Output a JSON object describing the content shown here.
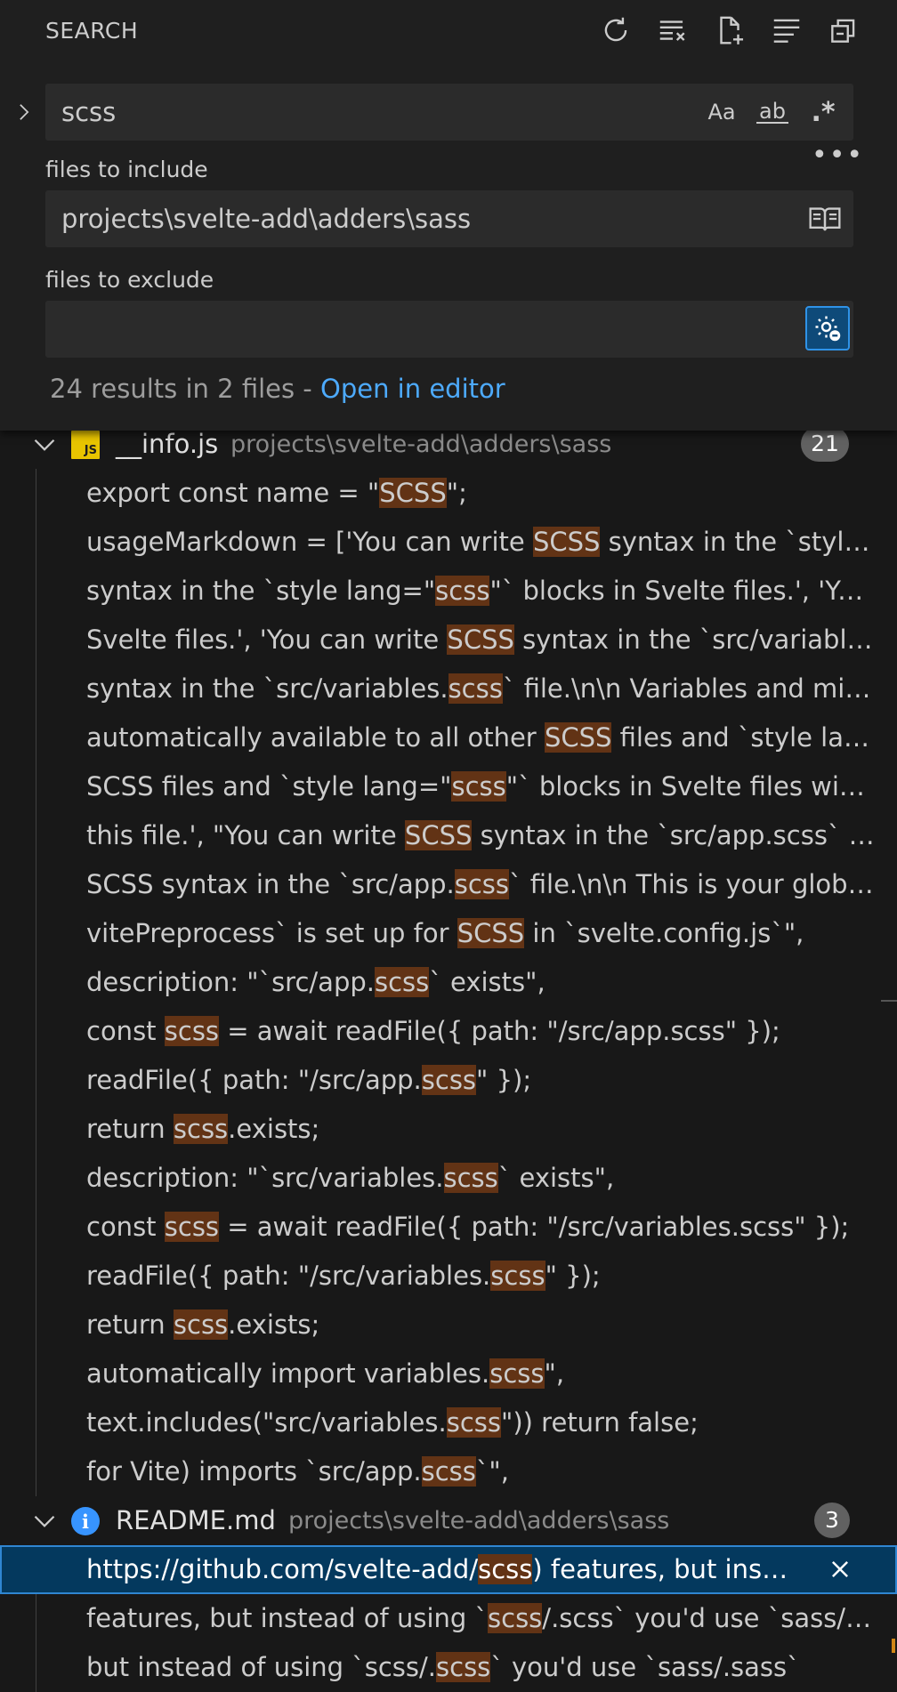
{
  "panel": {
    "title": "SEARCH",
    "toolbar": [
      {
        "name": "refresh-icon"
      },
      {
        "name": "clear-results-icon"
      },
      {
        "name": "new-search-editor-icon"
      },
      {
        "name": "view-as-tree-icon"
      },
      {
        "name": "collapse-all-icon"
      }
    ]
  },
  "search": {
    "query": "scss",
    "options": {
      "match_case": "Aa",
      "whole_word": "ab",
      "regex": ".*"
    },
    "include_label": "files to include",
    "include_value": "projects\\svelte-add\\adders\\sass",
    "exclude_label": "files to exclude",
    "exclude_value": "",
    "summary": "24 results in 2 files - ",
    "open_in_editor": "Open in editor"
  },
  "files": [
    {
      "name": "__info.js",
      "path": "projects\\svelte-add\\adders\\sass",
      "count": "21",
      "icon": "js-file-icon",
      "matches": [
        [
          {
            "t": "export const name = \""
          },
          {
            "t": "SCSS",
            "h": true
          },
          {
            "t": "\";"
          }
        ],
        [
          {
            "t": "usageMarkdown = ['You can write "
          },
          {
            "t": "SCSS",
            "h": true
          },
          {
            "t": " syntax in the `style l..."
          }
        ],
        [
          {
            "t": "syntax in the `style lang=\""
          },
          {
            "t": "scss",
            "h": true
          },
          {
            "t": "\"` blocks in Svelte files.', 'You c..."
          }
        ],
        [
          {
            "t": "Svelte files.', 'You can write "
          },
          {
            "t": "SCSS",
            "h": true
          },
          {
            "t": " syntax in the `src/variables.s..."
          }
        ],
        [
          {
            "t": "syntax in the `src/variables."
          },
          {
            "t": "scss",
            "h": true
          },
          {
            "t": "` file.\\n\\n  Variables and mixin..."
          }
        ],
        [
          {
            "t": "automatically available to all other "
          },
          {
            "t": "SCSS",
            "h": true
          },
          {
            "t": " files and `style lang..."
          }
        ],
        [
          {
            "t": "SCSS files and `style lang=\""
          },
          {
            "t": "scss",
            "h": true
          },
          {
            "t": "\"` blocks in Svelte files witho..."
          }
        ],
        [
          {
            "t": "this file.', \"You can write "
          },
          {
            "t": "SCSS",
            "h": true
          },
          {
            "t": " syntax in the `src/app.scss` file...."
          }
        ],
        [
          {
            "t": "SCSS syntax in the `src/app."
          },
          {
            "t": "scss",
            "h": true
          },
          {
            "t": "` file.\\n\\n  This is your global ..."
          }
        ],
        [
          {
            "t": "vitePreprocess` is set up for "
          },
          {
            "t": "SCSS",
            "h": true
          },
          {
            "t": " in `svelte.config.js`\","
          }
        ],
        [
          {
            "t": "description: \"`src/app."
          },
          {
            "t": "scss",
            "h": true
          },
          {
            "t": "` exists\","
          }
        ],
        [
          {
            "t": "const "
          },
          {
            "t": "scss",
            "h": true
          },
          {
            "t": " = await readFile({ path: \"/src/app.scss\" });"
          }
        ],
        [
          {
            "t": "readFile({ path: \"/src/app."
          },
          {
            "t": "scss",
            "h": true
          },
          {
            "t": "\" });"
          }
        ],
        [
          {
            "t": "return "
          },
          {
            "t": "scss",
            "h": true
          },
          {
            "t": ".exists;"
          }
        ],
        [
          {
            "t": "description: \"`src/variables."
          },
          {
            "t": "scss",
            "h": true
          },
          {
            "t": "` exists\","
          }
        ],
        [
          {
            "t": "const "
          },
          {
            "t": "scss",
            "h": true
          },
          {
            "t": " = await readFile({ path: \"/src/variables.scss\" });"
          }
        ],
        [
          {
            "t": "readFile({ path: \"/src/variables."
          },
          {
            "t": "scss",
            "h": true
          },
          {
            "t": "\" });"
          }
        ],
        [
          {
            "t": "return "
          },
          {
            "t": "scss",
            "h": true
          },
          {
            "t": ".exists;"
          }
        ],
        [
          {
            "t": "automatically import variables."
          },
          {
            "t": "scss",
            "h": true
          },
          {
            "t": "\","
          }
        ],
        [
          {
            "t": "text.includes(\"src/variables."
          },
          {
            "t": "scss",
            "h": true
          },
          {
            "t": "\")) return false;"
          }
        ],
        [
          {
            "t": "for Vite) imports `src/app."
          },
          {
            "t": "scss",
            "h": true
          },
          {
            "t": "`\","
          }
        ]
      ]
    },
    {
      "name": "README.md",
      "path": "projects\\svelte-add\\adders\\sass",
      "count": "3",
      "icon": "info-file-icon",
      "matches": [
        [
          {
            "t": "https://github.com/svelte-add/"
          },
          {
            "t": "scss",
            "h": true
          },
          {
            "t": ") features, but inst..."
          }
        ],
        [
          {
            "t": "features, but instead of using `"
          },
          {
            "t": "scss",
            "h": true
          },
          {
            "t": "/.scss` you'd use  `sass/.sa..."
          }
        ],
        [
          {
            "t": "but instead of using `scss/."
          },
          {
            "t": "scss",
            "h": true
          },
          {
            "t": "` you'd use  `sass/.sass`"
          }
        ]
      ]
    }
  ],
  "selected": {
    "file": 1,
    "line": 0
  }
}
